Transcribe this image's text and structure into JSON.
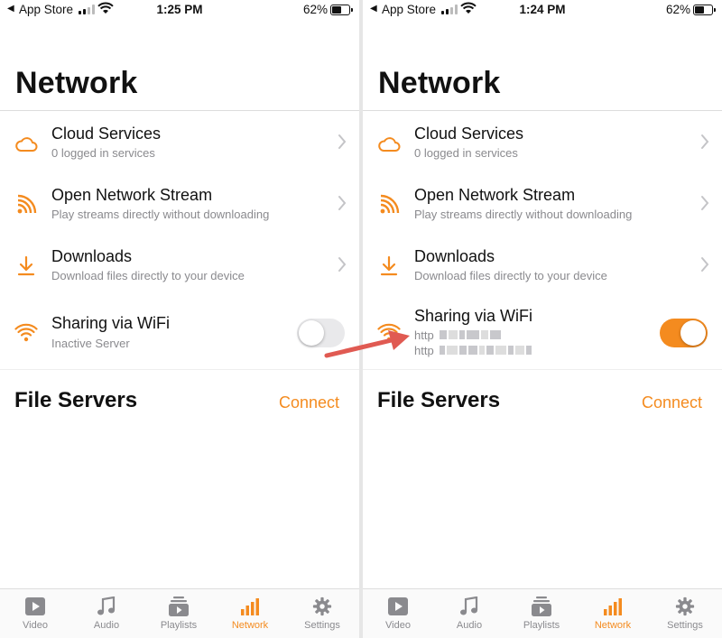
{
  "status_left": {
    "back_arrow": "◀",
    "carrier": "App Store",
    "time": "1:25 PM",
    "battery": "62%"
  },
  "status_right": {
    "back_arrow": "◀",
    "carrier": "App Store",
    "time": "1:24 PM",
    "battery": "62%"
  },
  "page": {
    "title": "Network"
  },
  "rows": {
    "cloud": {
      "label": "Cloud Services",
      "sub": "0 logged in services"
    },
    "stream": {
      "label": "Open Network Stream",
      "sub": "Play streams directly without downloading"
    },
    "downloads": {
      "label": "Downloads",
      "sub": "Download files directly to your device"
    },
    "sharing": {
      "label": "Sharing via WiFi",
      "sub_inactive": "Inactive Server",
      "url1_prefix": "http",
      "url2_prefix": "http"
    }
  },
  "toggle_state": {
    "left": "off",
    "right": "on"
  },
  "file_servers": {
    "title": "File Servers",
    "connect": "Connect"
  },
  "tabs": {
    "video": "Video",
    "audio": "Audio",
    "playlists": "Playlists",
    "network": "Network",
    "settings": "Settings",
    "active": "network"
  },
  "colors": {
    "accent": "#f48b1f",
    "secondary_text": "#8a8a8e",
    "arrow": "#e05a52"
  },
  "icons": [
    "cloud-icon",
    "rss-icon",
    "download-icon",
    "wifi-icon",
    "chevron-right-icon",
    "video-icon",
    "music-note-icon",
    "playlist-icon",
    "network-bars-icon",
    "gear-icon"
  ]
}
